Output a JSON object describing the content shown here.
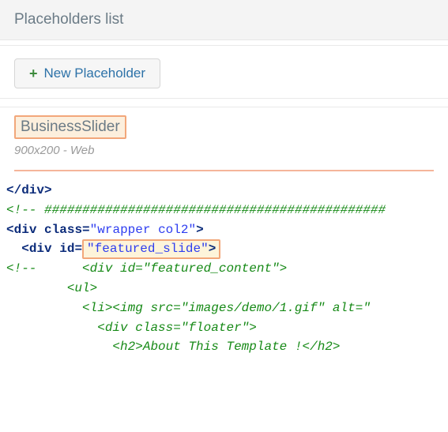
{
  "header": {
    "title": "Placeholders list"
  },
  "toolbar": {
    "new_label": "New Placeholder"
  },
  "item": {
    "title": "BusinessSlider",
    "meta": "900x200 - Web"
  },
  "code": {
    "l1_close_div": "div",
    "l2_comment_hashes": "#############################################",
    "l3_div": "div",
    "l3_class_attr": "class",
    "l3_class_val": "wrapper col2",
    "l4_div": "div",
    "l4_id_attr": "id",
    "l4_id_val": "featured_slide",
    "l5_comment": "<div id=\"featured_content\">",
    "l6_ul": "ul",
    "l7_li": "li",
    "l7_img": "img",
    "l7_src_attr": "src",
    "l7_src_val": "images/demo/1.gif",
    "l7_alt_attr": "alt",
    "l8_div": "div",
    "l8_class_attr": "class",
    "l8_class_val": "floater",
    "l9_h2": "h2",
    "l9_text": "About This Template !"
  }
}
